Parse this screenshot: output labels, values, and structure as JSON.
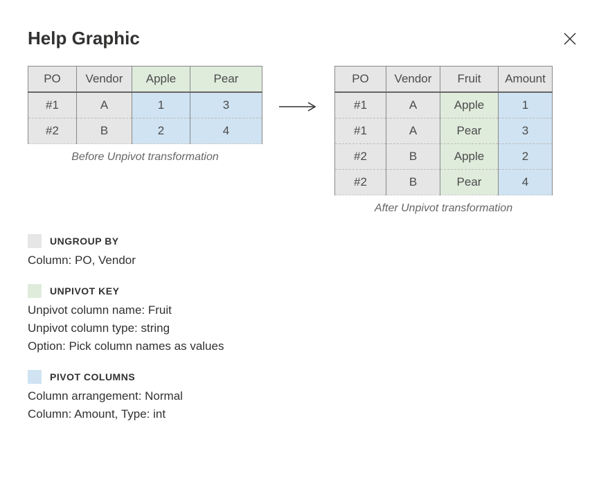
{
  "title": "Help Graphic",
  "before": {
    "headers": [
      "PO",
      "Vendor",
      "Apple",
      "Pear"
    ],
    "header_classes": [
      "bg-gray",
      "bg-gray",
      "bg-green",
      "bg-green"
    ],
    "rows": [
      {
        "cells": [
          "#1",
          "A",
          "1",
          "3"
        ],
        "classes": [
          "bg-gray",
          "bg-gray",
          "bg-blue",
          "bg-blue"
        ]
      },
      {
        "cells": [
          "#2",
          "B",
          "2",
          "4"
        ],
        "classes": [
          "bg-gray",
          "bg-gray",
          "bg-blue",
          "bg-blue"
        ]
      }
    ],
    "caption": "Before Unpivot transformation"
  },
  "after": {
    "headers": [
      "PO",
      "Vendor",
      "Fruit",
      "Amount"
    ],
    "header_classes": [
      "bg-gray",
      "bg-gray",
      "bg-gray",
      "bg-gray"
    ],
    "rows": [
      {
        "cells": [
          "#1",
          "A",
          "Apple",
          "1"
        ],
        "classes": [
          "bg-gray",
          "bg-gray",
          "bg-green",
          "bg-blue"
        ]
      },
      {
        "cells": [
          "#1",
          "A",
          "Pear",
          "3"
        ],
        "classes": [
          "bg-gray",
          "bg-gray",
          "bg-green",
          "bg-blue"
        ]
      },
      {
        "cells": [
          "#2",
          "B",
          "Apple",
          "2"
        ],
        "classes": [
          "bg-gray",
          "bg-gray",
          "bg-green",
          "bg-blue"
        ]
      },
      {
        "cells": [
          "#2",
          "B",
          "Pear",
          "4"
        ],
        "classes": [
          "bg-gray",
          "bg-gray",
          "bg-green",
          "bg-blue"
        ]
      }
    ],
    "caption": "After Unpivot transformation"
  },
  "legend": [
    {
      "swatch_class": "bg-gray",
      "title": "UNGROUP BY",
      "lines": [
        "Column: PO, Vendor"
      ]
    },
    {
      "swatch_class": "bg-green",
      "title": "UNPIVOT KEY",
      "lines": [
        "Unpivot column name: Fruit",
        "Unpivot column type: string",
        "Option: Pick column names as values"
      ]
    },
    {
      "swatch_class": "bg-blue",
      "title": "PIVOT COLUMNS",
      "lines": [
        "Column arrangement: Normal",
        "Column: Amount, Type: int"
      ]
    }
  ]
}
